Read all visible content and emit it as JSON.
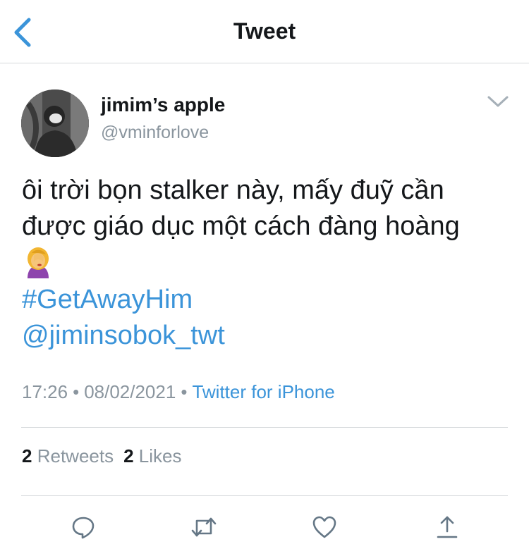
{
  "header": {
    "title": "Tweet",
    "back_icon": "chevron-left-icon"
  },
  "author": {
    "name": "jimim’s apple",
    "handle": "@vminforlove",
    "avatar_icon": "user-avatar"
  },
  "tweet": {
    "text_lines": [
      "ôi trời bọn stalker này, mấy đuỹ cần",
      "được giáo dục một cách đàng hoàng"
    ],
    "emoji": "facepalm-woman-emoji",
    "hashtag": "#GetAwayHim",
    "mention": "@jiminsobok_twt"
  },
  "meta": {
    "time": "17:26",
    "date": "08/02/2021",
    "separator": "•",
    "source": "Twitter for iPhone"
  },
  "stats": {
    "retweets_count": "2",
    "retweets_label": "Retweets",
    "likes_count": "2",
    "likes_label": "Likes"
  },
  "actions": {
    "icons": [
      "reply-icon",
      "retweet-icon",
      "like-icon",
      "share-icon"
    ]
  },
  "colors": {
    "accent": "#3b94d9",
    "secondary_text": "#8a959e",
    "primary_text": "#14171a",
    "divider": "#d6d9dc"
  }
}
